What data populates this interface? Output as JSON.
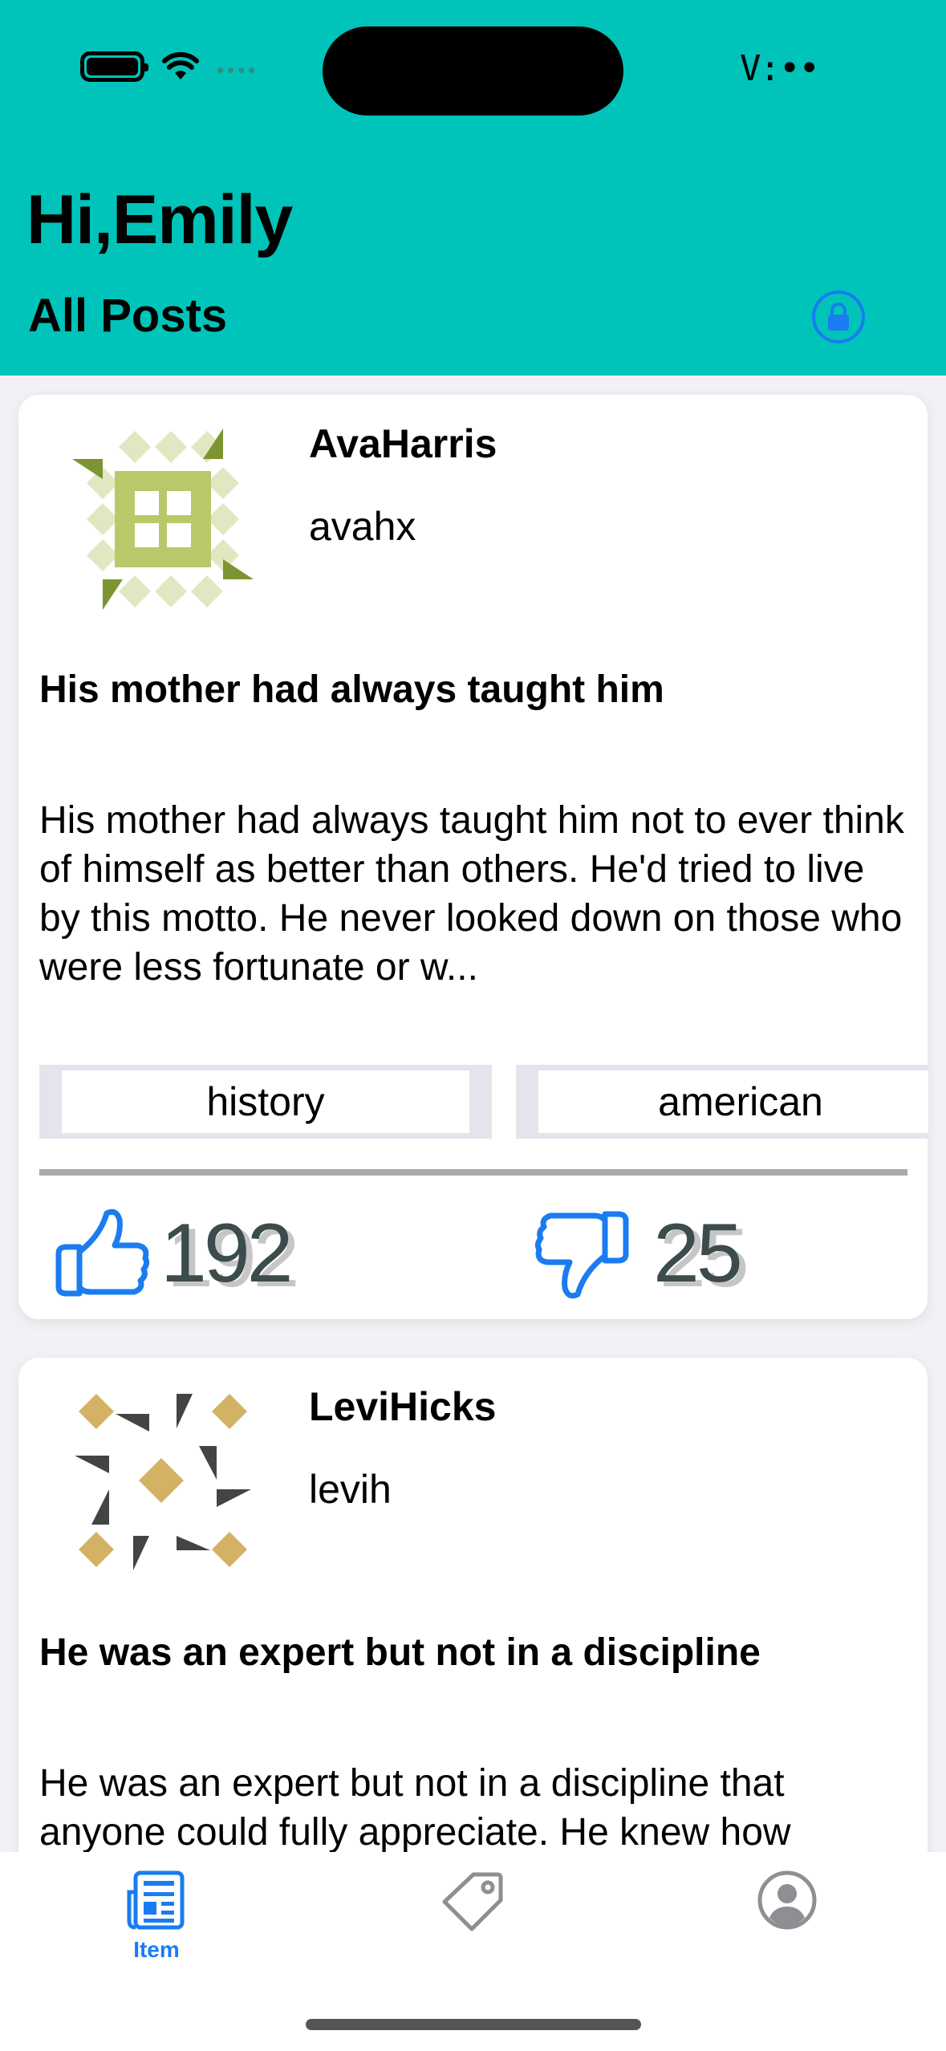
{
  "status_bar": {
    "time": "V:••",
    "signal": "••••"
  },
  "header": {
    "greeting": "Hi,Emily",
    "title": "All Posts",
    "lock_icon": "lock-icon"
  },
  "posts": [
    {
      "author_name": "AvaHarris",
      "author_handle": "avahx",
      "title": "His mother had always taught him",
      "body": "His mother had always taught him not to ever think of himself as better than others. He'd tried to live by this motto. He never looked down on those who were less fortunate or w...",
      "tags": [
        "history",
        "american"
      ],
      "likes": "192",
      "dislikes": "25",
      "avatar_colors": [
        "#b9c96a",
        "#e0e8c2",
        "#7d9432"
      ]
    },
    {
      "author_name": "LeviHicks",
      "author_handle": "levih",
      "title": "He was an expert but not in a discipline",
      "body": "He was an expert but not in a discipline that anyone could fully appreciate. He knew how",
      "avatar_colors": [
        "#d3b265",
        "#444444"
      ]
    }
  ],
  "tabbar": {
    "items": [
      {
        "label": "Item",
        "icon": "newspaper-icon",
        "active": true
      },
      {
        "label": "",
        "icon": "tag-icon",
        "active": false
      },
      {
        "label": "",
        "icon": "person-circle-icon",
        "active": false
      }
    ],
    "accent": "#1a7cf0",
    "inactive": "#8e8e93"
  },
  "colors": {
    "header_bg": "#00c4b9",
    "accent": "#1a7cf0"
  }
}
